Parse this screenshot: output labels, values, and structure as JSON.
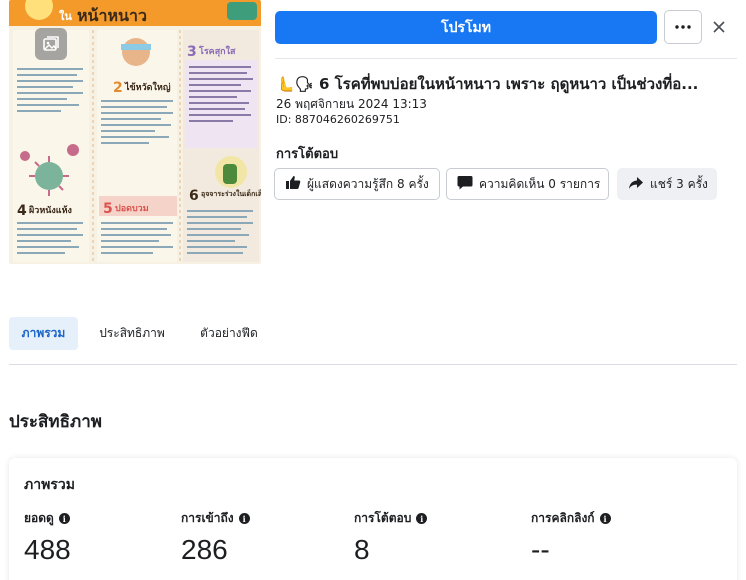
{
  "post": {
    "thumbnail": {
      "heading": "หน้าหนาว",
      "heading_prefix": "ใน",
      "items": [
        {
          "num": "2",
          "label": "ไข้หวัดใหญ่"
        },
        {
          "num": "3",
          "label": "โรคสุกใส"
        },
        {
          "num": "4",
          "label": "ผิวหนังแห้ง"
        },
        {
          "num": "5",
          "label": "ปอดบวม"
        },
        {
          "num": "6",
          "label": "อุจจาระร่วงในเด็กเล็ก"
        }
      ],
      "image_icon": "image-gallery-icon"
    },
    "title": "🫷🗣 6 โรคที่พบบ่อยในหน้าหนาว เพราะ ฤดูหนาว เป็นช่วงที่อ...",
    "date": "26 พฤศจิกายน 2024 13:13",
    "id": "ID: 887046260269751"
  },
  "toolbar": {
    "promote_label": "โปรโมท",
    "more_icon": "more-dots-icon",
    "close_icon": "close-icon"
  },
  "engagement": {
    "title": "การโต้ตอบ",
    "reactions": "ผู้แสดงความรู้สึก 8 ครั้ง",
    "comments": "ความคิดเห็น 0 รายการ",
    "shares": "แชร์ 3 ครั้ง"
  },
  "tabs": [
    {
      "label": "ภาพรวม",
      "active": true
    },
    {
      "label": "ประสิทธิภาพ",
      "active": false
    },
    {
      "label": "ตัวอย่างฟีด",
      "active": false
    }
  ],
  "performance": {
    "section_title": "ประสิทธิภาพ",
    "card_title": "ภาพรวม",
    "metrics": [
      {
        "label": "ยอดดู",
        "value": "488"
      },
      {
        "label": "การเข้าถึง",
        "value": "286"
      },
      {
        "label": "การโต้ตอบ",
        "value": "8"
      },
      {
        "label": "การคลิกลิงก์",
        "value": "--"
      }
    ]
  },
  "colors": {
    "primary": "#1877f2",
    "tab_active_bg": "#e6f0fb",
    "tab_active_text": "#1a66c8"
  }
}
